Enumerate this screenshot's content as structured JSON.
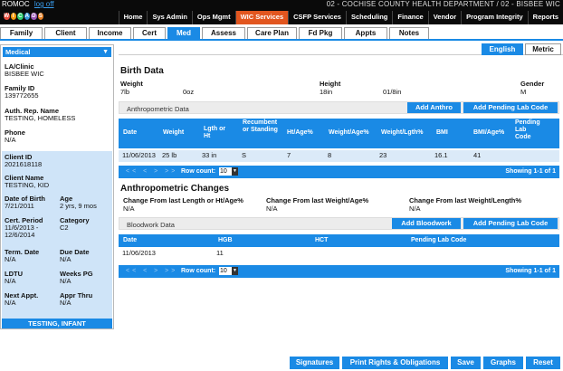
{
  "header": {
    "user": "ROMOC",
    "logout": "log off",
    "department": "02 - COCHISE COUNTY HEALTH DEPARTMENT / 02 - BISBEE WIC",
    "logo_letters": [
      "W",
      "I",
      "C",
      "A",
      "D",
      "S"
    ],
    "menu": [
      "Home",
      "Sys Admin",
      "Ops Mgmt",
      "WIC Services",
      "CSFP Services",
      "Scheduling",
      "Finance",
      "Vendor",
      "Program Integrity",
      "Reports"
    ],
    "active_menu": "WIC Services"
  },
  "tabs": [
    "Family",
    "Client",
    "Income",
    "Cert",
    "Med",
    "Assess",
    "Care Plan",
    "Fd Pkg",
    "Appts",
    "Notes"
  ],
  "active_tab": "Med",
  "sidebar": {
    "selector": "Medical",
    "la_clinic_label": "LA/Clinic",
    "la_clinic": "BISBEE WIC",
    "family_id_label": "Family ID",
    "family_id": "139772655",
    "auth_rep_label": "Auth. Rep. Name",
    "auth_rep": "TESTING, HOMELESS",
    "phone_label": "Phone",
    "phone": "N/A",
    "client_id_label": "Client ID",
    "client_id": "2021618118",
    "client_name_label": "Client Name",
    "client_name": "TESTING, KID",
    "dob_label": "Date of Birth",
    "dob": "7/21/2011",
    "age_label": "Age",
    "age": "2 yrs, 9 mos",
    "cert_period_label": "Cert. Period",
    "cert_period_1": "11/6/2013 -",
    "cert_period_2": "12/6/2014",
    "category_label": "Category",
    "category": "C2",
    "term_date_label": "Term. Date",
    "term_date": "N/A",
    "due_date_label": "Due Date",
    "due_date": "N/A",
    "ldtu_label": "LDTU",
    "ldtu": "N/A",
    "weeks_pg_label": "Weeks PG",
    "weeks_pg": "N/A",
    "next_appt_label": "Next Appt.",
    "next_appt": "N/A",
    "appr_thru_label": "Appr Thru",
    "appr_thru": "N/A",
    "footer": "TESTING, INFANT"
  },
  "lang": {
    "english": "English",
    "metric": "Metric"
  },
  "birth": {
    "title": "Birth Data",
    "weight_label": "Weight",
    "weight_lb": "7lb",
    "weight_oz": "0oz",
    "height_label": "Height",
    "height_in": "18in",
    "height_frac": "01/8in",
    "gender_label": "Gender",
    "gender": "M"
  },
  "anthro": {
    "title": "Anthropometric Data",
    "add_btn": "Add Anthro",
    "add_lab_btn": "Add Pending Lab Code",
    "columns": [
      "Date",
      "Weight",
      "Lgth or Ht",
      "Recumbent or Standing",
      "Ht/Age%",
      "Weight/Age%",
      "Weight/Lgth%",
      "BMI",
      "BMI/Age%",
      "Pending Lab Code"
    ],
    "row": [
      "11/06/2013",
      "25 lb",
      "33 in",
      "S",
      "7",
      "8",
      "23",
      "16.1",
      "41",
      ""
    ],
    "row_count_label": "Row count:",
    "row_count": "10",
    "showing": "Showing 1-1 of 1",
    "nav": "<< < > >>"
  },
  "changes": {
    "title": "Anthropometric Changes",
    "c1_label": "Change From last Length or Ht/Age%",
    "c1_value": "N/A",
    "c2_label": "Change From last Weight/Age%",
    "c2_value": "N/A",
    "c3_label": "Change From last Weight/Length%",
    "c3_value": "N/A"
  },
  "blood": {
    "title": "Bloodwork Data",
    "add_btn": "Add Bloodwork",
    "add_lab_btn": "Add Pending Lab Code",
    "columns": [
      "Date",
      "HGB",
      "HCT",
      "Pending Lab Code"
    ],
    "row": [
      "11/06/2013",
      "11",
      "",
      ""
    ],
    "row_count_label": "Row count:",
    "row_count": "10",
    "showing": "Showing 1-1 of 1",
    "nav": "<< < > >>"
  },
  "bottom": [
    "Signatures",
    "Print Rights & Obligations",
    "Save",
    "Graphs",
    "Reset"
  ],
  "colors": {
    "accent": "#1a8ae5",
    "active_menu": "#e2561f",
    "row": "#dbeaf8",
    "client_panel": "#cfe4f8"
  }
}
